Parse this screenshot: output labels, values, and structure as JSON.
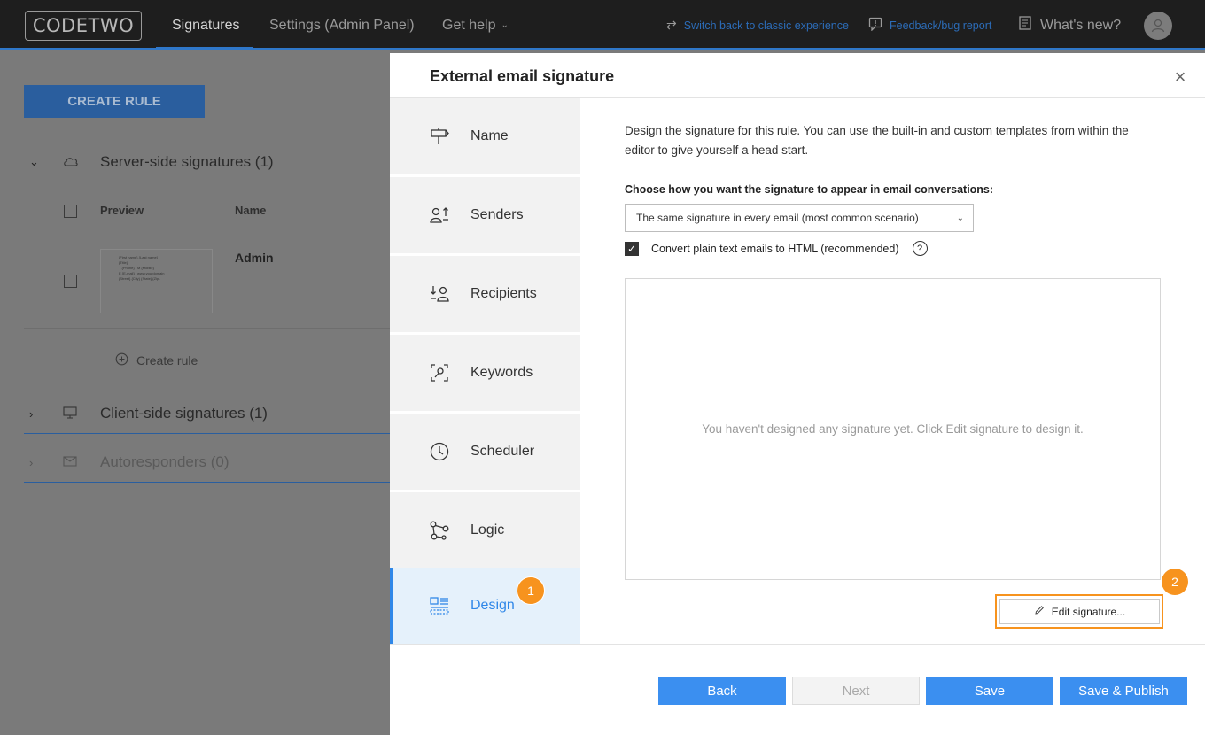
{
  "topbar": {
    "logo": "CODETWO",
    "nav": [
      "Signatures",
      "Settings (Admin Panel)",
      "Get help"
    ],
    "switch_link": "Switch back to classic experience",
    "feedback_link": "Feedback/bug report",
    "whats_new": "What's new?"
  },
  "background": {
    "create_rule_button": "CREATE RULE",
    "sections": [
      {
        "label": "Server-side signatures (1)"
      },
      {
        "label": "Client-side signatures (1)"
      },
      {
        "label": "Autoresponders (0)"
      }
    ],
    "columns": {
      "preview": "Preview",
      "name": "Name"
    },
    "row_name": "Admin",
    "preview_lines": [
      "{First name} {Last name}",
      "{Title}",
      "T {Phone} | M {Mobile}",
      "E {E-mail} | www.yourdomain",
      "{Street} {City} {State} {Zip}"
    ],
    "create_rule_link": "Create rule"
  },
  "modal": {
    "title": "External email signature",
    "close": "×",
    "steps": [
      {
        "label": "Name"
      },
      {
        "label": "Senders"
      },
      {
        "label": "Recipients"
      },
      {
        "label": "Keywords"
      },
      {
        "label": "Scheduler"
      },
      {
        "label": "Logic"
      },
      {
        "label": "Design"
      }
    ],
    "active_step": "Design",
    "description": "Design the signature for this rule. You can use the built-in and custom templates from within the editor to give yourself a head start.",
    "choose_label": "Choose how you want the signature to appear in email conversations:",
    "select_value": "The same signature in every email (most common scenario)",
    "convert_label": "Convert plain text emails to HTML (recommended)",
    "convert_checked": true,
    "empty_message": "You haven't designed any signature yet. Click Edit signature to design it.",
    "edit_button": "Edit signature...",
    "badges": [
      "1",
      "2"
    ],
    "footer": {
      "back": "Back",
      "next": "Next",
      "save": "Save",
      "save_publish": "Save & Publish"
    }
  },
  "colors": {
    "accent": "#3b8ff0",
    "highlight": "#f7931e",
    "topbar": "#1e1e1e"
  }
}
